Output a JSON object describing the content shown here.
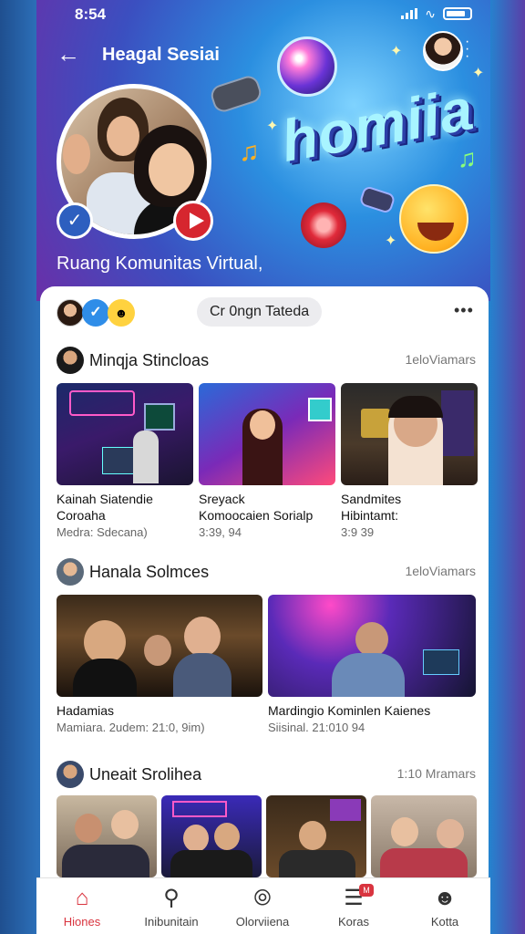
{
  "status": {
    "time": "8:54"
  },
  "nav": {
    "title": "Heagal Sesiai"
  },
  "hero": {
    "logo": "homiia",
    "caption": "Ruang Komunitas Virtual,"
  },
  "filter": {
    "chip_label": "Cr 0ngn Tateda"
  },
  "sections": [
    {
      "title": "Minqja Stincloas",
      "count": "1eloViamars",
      "tiles": [
        {
          "title": "Kainah Siatendie\nCoroaha",
          "subtitle": "Medra: Sdecana)"
        },
        {
          "title": "Sreyack\nKomoocaien Sorialp",
          "subtitle": "3:39, 94"
        },
        {
          "title": "Sandmites\nHibintamt:",
          "subtitle": "3:9 39"
        }
      ]
    },
    {
      "title": "Hanala Solmces",
      "count": "1eloViamars",
      "tiles": [
        {
          "title": "Hadamias",
          "subtitle": "Mamiara. 2udem: 21:0, 9im)"
        },
        {
          "title": "Mardingio Kominlen Kaienes",
          "subtitle": "Siisinal. 21:010 94"
        }
      ]
    },
    {
      "title": "Uneait Srolihea",
      "count": "1:10 Mramars"
    }
  ],
  "tabs": [
    {
      "label": "Hiones",
      "icon": "home-icon"
    },
    {
      "label": "Inibunitain",
      "icon": "search-icon"
    },
    {
      "label": "Olorviiena",
      "icon": "compass-icon"
    },
    {
      "label": "Koras",
      "icon": "feed-icon",
      "badge": "M"
    },
    {
      "label": "Kotta",
      "icon": "profile-icon"
    }
  ],
  "colors": {
    "accent": "#d9343f",
    "blue_badge": "#2f8de8"
  }
}
